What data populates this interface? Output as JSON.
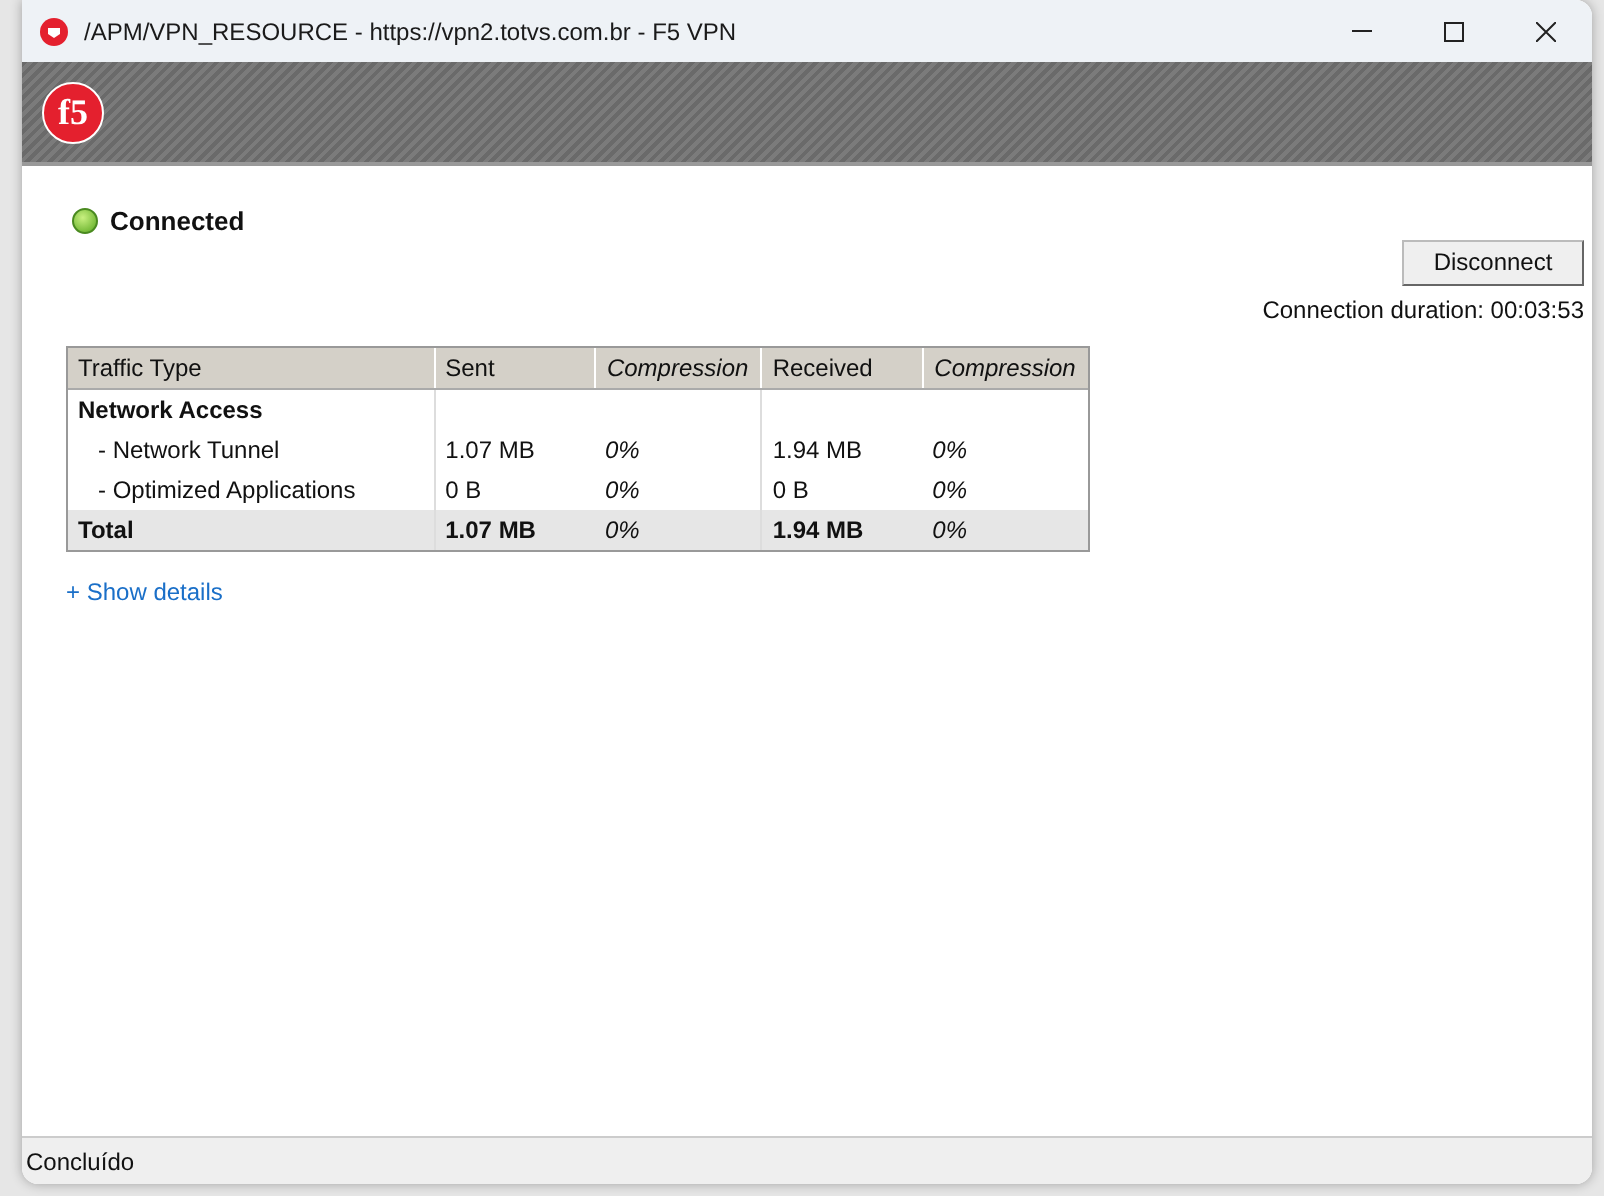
{
  "window": {
    "title": "/APM/VPN_RESOURCE - https://vpn2.totvs.com.br - F5 VPN"
  },
  "logo": "f5",
  "status": {
    "label": "Connected",
    "connected": true
  },
  "disconnect_button": "Disconnect",
  "duration": "Connection duration: 00:03:53",
  "table": {
    "columns": [
      {
        "label": "Traffic Type",
        "italic": false
      },
      {
        "label": "Sent",
        "italic": false
      },
      {
        "label": "Compression",
        "italic": true
      },
      {
        "label": "Received",
        "italic": false
      },
      {
        "label": "Compression",
        "italic": true
      }
    ],
    "rows": [
      {
        "kind": "group",
        "cells": [
          "Network Access"
        ]
      },
      {
        "kind": "item",
        "cells": [
          "- Network Tunnel",
          "1.07 MB",
          "0%",
          "1.94 MB",
          "0%"
        ]
      },
      {
        "kind": "item",
        "cells": [
          "- Optimized Applications",
          "0 B",
          "0%",
          "0 B",
          "0%"
        ]
      },
      {
        "kind": "total",
        "cells": [
          "Total",
          "1.07 MB",
          "0%",
          "1.94 MB",
          "0%"
        ]
      }
    ]
  },
  "details_link": "+ Show details",
  "status_bar": "Concluído"
}
